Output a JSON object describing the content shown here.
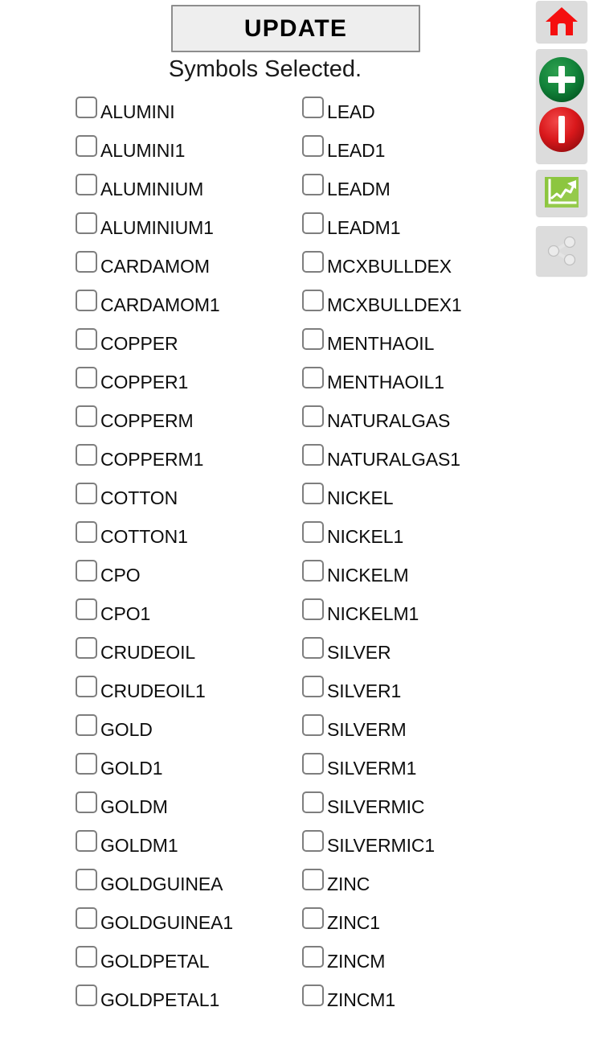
{
  "header": {
    "update_label": "UPDATE",
    "status_text": "Symbols Selected."
  },
  "symbols": {
    "left_column": [
      {
        "label": "ALUMINI",
        "checked": false
      },
      {
        "label": "ALUMINI1",
        "checked": false
      },
      {
        "label": "ALUMINIUM",
        "checked": false
      },
      {
        "label": "ALUMINIUM1",
        "checked": false
      },
      {
        "label": "CARDAMOM",
        "checked": false
      },
      {
        "label": "CARDAMOM1",
        "checked": false
      },
      {
        "label": "COPPER",
        "checked": false
      },
      {
        "label": "COPPER1",
        "checked": false
      },
      {
        "label": "COPPERM",
        "checked": false
      },
      {
        "label": "COPPERM1",
        "checked": false
      },
      {
        "label": "COTTON",
        "checked": false
      },
      {
        "label": "COTTON1",
        "checked": false
      },
      {
        "label": "CPO",
        "checked": false
      },
      {
        "label": "CPO1",
        "checked": false
      },
      {
        "label": "CRUDEOIL",
        "checked": false
      },
      {
        "label": "CRUDEOIL1",
        "checked": false
      },
      {
        "label": "GOLD",
        "checked": false
      },
      {
        "label": "GOLD1",
        "checked": false
      },
      {
        "label": "GOLDM",
        "checked": false
      },
      {
        "label": "GOLDM1",
        "checked": false
      },
      {
        "label": "GOLDGUINEA",
        "checked": false
      },
      {
        "label": "GOLDGUINEA1",
        "checked": false
      },
      {
        "label": "GOLDPETAL",
        "checked": false
      },
      {
        "label": "GOLDPETAL1",
        "checked": false
      }
    ],
    "right_column": [
      {
        "label": "LEAD",
        "checked": false
      },
      {
        "label": "LEAD1",
        "checked": false
      },
      {
        "label": "LEADM",
        "checked": false
      },
      {
        "label": "LEADM1",
        "checked": false
      },
      {
        "label": "MCXBULLDEX",
        "checked": false
      },
      {
        "label": "MCXBULLDEX1",
        "checked": false
      },
      {
        "label": "MENTHAOIL",
        "checked": false
      },
      {
        "label": "MENTHAOIL1",
        "checked": false
      },
      {
        "label": "NATURALGAS",
        "checked": false
      },
      {
        "label": "NATURALGAS1",
        "checked": false
      },
      {
        "label": "NICKEL",
        "checked": false
      },
      {
        "label": "NICKEL1",
        "checked": false
      },
      {
        "label": "NICKELM",
        "checked": false
      },
      {
        "label": "NICKELM1",
        "checked": false
      },
      {
        "label": "SILVER",
        "checked": false
      },
      {
        "label": "SILVER1",
        "checked": false
      },
      {
        "label": "SILVERM",
        "checked": false
      },
      {
        "label": "SILVERM1",
        "checked": false
      },
      {
        "label": "SILVERMIC",
        "checked": false
      },
      {
        "label": "SILVERMIC1",
        "checked": false
      },
      {
        "label": "ZINC",
        "checked": false
      },
      {
        "label": "ZINC1",
        "checked": false
      },
      {
        "label": "ZINCM",
        "checked": false
      },
      {
        "label": "ZINCM1",
        "checked": false
      }
    ]
  },
  "toolbar": {
    "buttons": [
      {
        "name": "home-icon",
        "tooltip": "Home"
      },
      {
        "name": "add-remove-icon",
        "tooltip": "Add / Remove"
      },
      {
        "name": "chart-icon",
        "tooltip": "Chart"
      },
      {
        "name": "share-icon",
        "tooltip": "Share"
      }
    ]
  },
  "colors": {
    "home_red": "#f50f0f",
    "plus_green": "#0d7c2f",
    "minus_red": "#d9181b",
    "chart_green": "#8cc63f",
    "share_gray": "#e9e9e9",
    "button_face": "#eeeeee",
    "button_border": "#8d8d8d",
    "toolbar_face": "#dcdcdc",
    "checkbox_border": "#7e7e7e",
    "background": "#ffffff"
  }
}
